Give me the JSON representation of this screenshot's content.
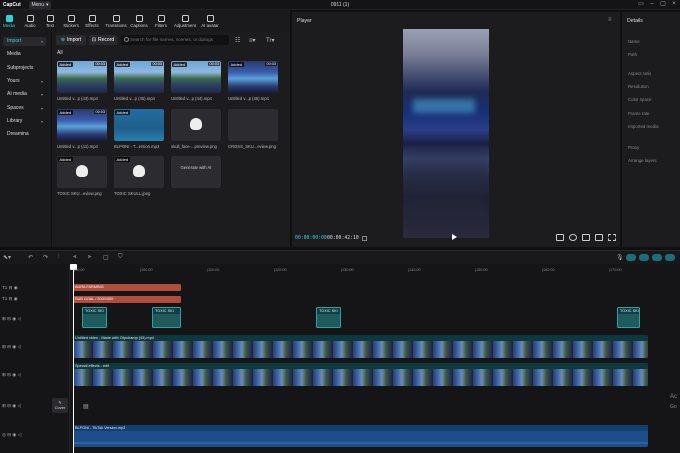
{
  "titlebar": {
    "app_name": "CapCut",
    "menu_label": "Menu",
    "document_title": "0911 (1)"
  },
  "toolbar": {
    "tools": [
      "Media",
      "Audio",
      "Text",
      "Stickers",
      "Effects",
      "Transitions",
      "Captions",
      "Filters",
      "Adjustment",
      "AI avatar"
    ],
    "active_tool": "Media",
    "accent_color": "#2fd4d4"
  },
  "leftnav": {
    "items": [
      {
        "label": "Import",
        "active": true,
        "chevron": true
      },
      {
        "label": "Media",
        "active": false
      },
      {
        "label": "Subprojects",
        "active": false
      },
      {
        "label": "Yours",
        "active": false,
        "chevron": true
      },
      {
        "label": "AI media",
        "active": false,
        "chevron": true
      },
      {
        "label": "Spaces",
        "active": false,
        "chevron": true
      },
      {
        "label": "Library",
        "active": false,
        "chevron": true
      },
      {
        "label": "Dreamina",
        "active": false
      }
    ]
  },
  "media": {
    "import_label": "Import",
    "record_label": "Record",
    "search_placeholder": "Search for file names, scenes, or dialogs",
    "filter_label": "All",
    "sort_label": "Tr",
    "items": [
      {
        "caption": "Untitled v...p (43).mp4",
        "added": "Added",
        "duration": "00:03",
        "style": "game"
      },
      {
        "caption": "Untitled v...p (45).mp4",
        "added": "Added",
        "duration": "00:03",
        "style": "game"
      },
      {
        "caption": "Untitled v...p (44).mp4",
        "added": "Added",
        "duration": "00:03",
        "style": "game"
      },
      {
        "caption": "Untitled v...p (46).mp4",
        "added": "Added",
        "duration": "00:03",
        "style": "game2"
      },
      {
        "caption": "Untitled v...p (41).mp4",
        "added": "Added",
        "duration": "00:03",
        "style": "game2"
      },
      {
        "caption": "BLPONI - T...ersion.mp3",
        "added": "Added",
        "duration": "",
        "style": "blue"
      },
      {
        "caption": "skull_face-...preview.png",
        "added": "",
        "duration": "",
        "style": "skull"
      },
      {
        "caption": "CROSS_SKU...eview.png",
        "added": "",
        "duration": "",
        "style": "dark"
      },
      {
        "caption": "TOXIC SKU...eview.png",
        "added": "Added",
        "duration": "",
        "style": "skull"
      },
      {
        "caption": "TOXIC SKULL.jpeg",
        "added": "Added",
        "duration": "",
        "style": "skull"
      },
      {
        "caption": "Generate with AI",
        "added": "",
        "duration": "",
        "style": "gen"
      }
    ]
  },
  "player": {
    "title": "Player",
    "current_time": "00:00:00:00",
    "total_time": "00:00:42:10"
  },
  "details": {
    "title": "Details",
    "fields": [
      "Name",
      "Path",
      "Aspect ratio",
      "Resolution",
      "Color space",
      "Frame rate",
      "Imported media",
      "Proxy",
      "Arrange layers"
    ]
  },
  "timeline": {
    "ruler_ticks": [
      "00:00",
      "100:00",
      "110:00",
      "120:00",
      "130:00",
      "140:00",
      "150:00",
      "160:00",
      "170:00"
    ],
    "text_tracks": [
      {
        "label": "AURA FARMING"
      },
      {
        "label": "SUB GOAL / 200/1000"
      }
    ],
    "sticker_label": "TOXIC SKI",
    "video_clip_label": "Untitled video - Made with Clipchamp (43).mp4",
    "effect_clip_label": "Special effects - edit",
    "cover_label": "Cover",
    "audio_label": "BLPONI - TikTok Version.mp3",
    "side_text_1": "Ac",
    "side_text_2": "Go"
  }
}
